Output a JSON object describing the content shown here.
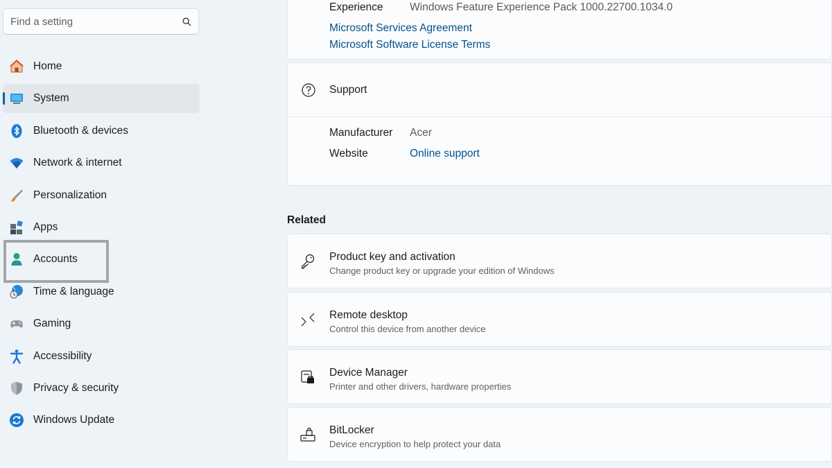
{
  "search": {
    "placeholder": "Find a setting",
    "icon": "search-icon"
  },
  "sidebar": {
    "items": [
      {
        "label": "Home",
        "icon": "home-icon"
      },
      {
        "label": "System",
        "icon": "system-monitor-icon",
        "selected": true
      },
      {
        "label": "Bluetooth & devices",
        "icon": "bluetooth-icon"
      },
      {
        "label": "Network & internet",
        "icon": "wifi-icon"
      },
      {
        "label": "Personalization",
        "icon": "paintbrush-icon"
      },
      {
        "label": "Apps",
        "icon": "apps-icon"
      },
      {
        "label": "Accounts",
        "icon": "account-icon"
      },
      {
        "label": "Time & language",
        "icon": "globe-clock-icon"
      },
      {
        "label": "Gaming",
        "icon": "gamepad-icon"
      },
      {
        "label": "Accessibility",
        "icon": "accessibility-icon"
      },
      {
        "label": "Privacy & security",
        "icon": "shield-icon"
      },
      {
        "label": "Windows Update",
        "icon": "update-icon"
      }
    ]
  },
  "main": {
    "top_card": {
      "key": "Experience",
      "value": "Windows Feature Experience Pack 1000.22700.1034.0",
      "link1": "Microsoft Services Agreement",
      "link2": "Microsoft Software License Terms"
    },
    "support": {
      "title": "Support",
      "manufacturer_key": "Manufacturer",
      "manufacturer_value": "Acer",
      "website_key": "Website",
      "website_value": "Online support"
    },
    "related": {
      "heading": "Related",
      "items": [
        {
          "title": "Product key and activation",
          "desc": "Change product key or upgrade your edition of Windows",
          "icon": "key-icon"
        },
        {
          "title": "Remote desktop",
          "desc": "Control this device from another device",
          "icon": "remote-desktop-icon"
        },
        {
          "title": "Device Manager",
          "desc": "Printer and other drivers, hardware properties",
          "icon": "device-manager-icon"
        },
        {
          "title": "BitLocker",
          "desc": "Device encryption to help protect your data",
          "icon": "bitlocker-icon"
        }
      ]
    }
  },
  "colors": {
    "accent": "#005fb8",
    "link": "#00518f",
    "background": "#eef3f8",
    "card": "#fbfcfd"
  }
}
